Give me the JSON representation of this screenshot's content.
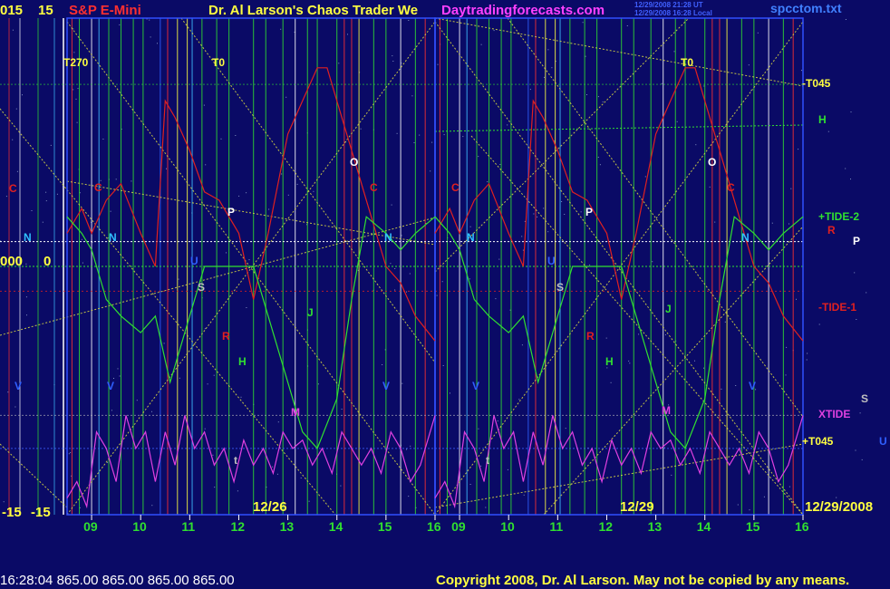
{
  "header": {
    "left_values": [
      "015",
      "15"
    ],
    "instrument": "S&P E-Mini",
    "title": "Dr. Al Larson's Chaos Trader We",
    "site": "Daytradingforecasts.com",
    "stamp_line1": "12/29/2008 21:28 UT",
    "stamp_line2": "12/29/2008 16:28 Local",
    "file": "spcctom.txt"
  },
  "left_axis": {
    "mid_values": [
      "000",
      "0"
    ],
    "low_values": [
      "-15",
      "-15"
    ]
  },
  "status_bar": {
    "time": "16:28:04",
    "quotes": [
      "865.00",
      "865.00",
      "865.00",
      "865.00"
    ],
    "copyright": "Copyright 2008, Dr. Al Larson. May not be copied by any means."
  },
  "colors": {
    "background": "#0a0a66",
    "price": "#e02020",
    "tide": "#30e030",
    "xtide": "#e040e0",
    "guides": "#e0e040"
  },
  "chart_data": {
    "type": "line",
    "title": "S&P E-Mini",
    "sessions": [
      {
        "date_label": "12/26",
        "hours": [
          "09",
          "10",
          "11",
          "12",
          "13",
          "14",
          "15",
          "16"
        ]
      },
      {
        "date_label": "12/29",
        "hours": [
          "09",
          "10",
          "11",
          "12",
          "13",
          "14",
          "15",
          "16"
        ]
      }
    ],
    "end_date_label": "12/29/2008",
    "x_range": [
      8.5,
      16.0
    ],
    "y_range": [
      -15,
      15
    ],
    "right_labels": [
      {
        "text": "-T045",
        "color": "#ffff40"
      },
      {
        "text": "H",
        "color": "#30e030"
      },
      {
        "text": "+TIDE-2",
        "color": "#30e030"
      },
      {
        "text": "R",
        "color": "#e02020"
      },
      {
        "text": "P",
        "color": "#ffffff"
      },
      {
        "text": "-TIDE-1",
        "color": "#e02020"
      },
      {
        "text": "S",
        "color": "#c0c0c0"
      },
      {
        "text": "XTIDE",
        "color": "#e040e0"
      },
      {
        "text": "+T045",
        "color": "#ffff40"
      },
      {
        "text": "U",
        "color": "#3060ff"
      }
    ],
    "markers": [
      {
        "text": "T270",
        "color": "#ffff40"
      },
      {
        "text": "T0",
        "color": "#ffff40"
      },
      {
        "text": "T0",
        "color": "#ffff40"
      },
      {
        "text": "C",
        "color": "#e02020"
      },
      {
        "text": "C",
        "color": "#e02020"
      },
      {
        "text": "C",
        "color": "#e02020"
      },
      {
        "text": "C",
        "color": "#e02020"
      },
      {
        "text": "C",
        "color": "#e02020"
      },
      {
        "text": "N",
        "color": "#30c0ff"
      },
      {
        "text": "N",
        "color": "#30c0ff"
      },
      {
        "text": "N",
        "color": "#30c0ff"
      },
      {
        "text": "N",
        "color": "#30c0ff"
      },
      {
        "text": "N",
        "color": "#30c0ff"
      },
      {
        "text": "U",
        "color": "#3060ff"
      },
      {
        "text": "U",
        "color": "#3060ff"
      },
      {
        "text": "S",
        "color": "#c0c0c0"
      },
      {
        "text": "S",
        "color": "#c0c0c0"
      },
      {
        "text": "P",
        "color": "#ffffff"
      },
      {
        "text": "P",
        "color": "#ffffff"
      },
      {
        "text": "O",
        "color": "#ffffff"
      },
      {
        "text": "O",
        "color": "#ffffff"
      },
      {
        "text": "R",
        "color": "#e02020"
      },
      {
        "text": "R",
        "color": "#e02020"
      },
      {
        "text": "H",
        "color": "#30e030"
      },
      {
        "text": "H",
        "color": "#30e030"
      },
      {
        "text": "J",
        "color": "#30e030"
      },
      {
        "text": "J",
        "color": "#30e030"
      },
      {
        "text": "M",
        "color": "#e040e0"
      },
      {
        "text": "M",
        "color": "#e040e0"
      },
      {
        "text": "V",
        "color": "#3060ff"
      },
      {
        "text": "V",
        "color": "#3060ff"
      },
      {
        "text": "V",
        "color": "#3060ff"
      },
      {
        "text": "V",
        "color": "#3060ff"
      },
      {
        "text": "V",
        "color": "#3060ff"
      },
      {
        "text": "t",
        "color": "#c0c0c0"
      },
      {
        "text": "t",
        "color": "#c0c0c0"
      }
    ],
    "series": [
      {
        "name": "",
        "color": "#e02020",
        "x": [
          8.5,
          8.8,
          9.0,
          9.3,
          9.6,
          10.0,
          10.3,
          10.5,
          10.7,
          11.0,
          11.3,
          11.6,
          12.0,
          12.3,
          12.6,
          13.0,
          13.3,
          13.6,
          13.8,
          14.0,
          14.3,
          14.6,
          15.0,
          15.3,
          15.6,
          16.0
        ],
        "y": [
          2,
          3.5,
          2,
          4,
          5,
          2,
          0,
          10,
          9,
          7,
          4.5,
          4,
          2,
          -2,
          2,
          8,
          10,
          12,
          12,
          10,
          7,
          4,
          0,
          -1,
          -3,
          -4.5
        ]
      },
      {
        "name": "",
        "color": "#30e030",
        "x": [
          8.5,
          8.8,
          9.0,
          9.3,
          9.6,
          10.0,
          10.3,
          10.6,
          11.0,
          11.3,
          11.6,
          12.0,
          12.3,
          12.6,
          13.0,
          13.3,
          13.6,
          14.0,
          14.3,
          14.6,
          15.0,
          15.3,
          15.6,
          16.0
        ],
        "y": [
          3,
          2,
          1,
          -2,
          -3,
          -4,
          -3,
          -7,
          -3,
          0,
          0,
          0,
          0,
          -3,
          -7,
          -10,
          -11,
          -8,
          -2,
          3,
          2,
          1,
          2,
          3
        ]
      },
      {
        "name": "",
        "color": "#e040e0",
        "x": [
          8.5,
          8.7,
          8.9,
          9.1,
          9.3,
          9.5,
          9.7,
          9.9,
          10.1,
          10.3,
          10.5,
          10.7,
          10.9,
          11.1,
          11.3,
          11.5,
          11.7,
          11.9,
          12.1,
          12.3,
          12.5,
          12.7,
          12.9,
          13.1,
          13.3,
          13.5,
          13.7,
          13.9,
          14.1,
          14.3,
          14.5,
          14.7,
          14.9,
          15.1,
          15.3,
          15.5,
          15.7,
          16.0
        ],
        "y": [
          -14,
          -13,
          -14.5,
          -10,
          -11,
          -13,
          -9,
          -11,
          -10,
          -13,
          -10,
          -12,
          -9,
          -11,
          -10,
          -12,
          -11,
          -13,
          -10.5,
          -12,
          -11,
          -12.5,
          -10,
          -11,
          -10.5,
          -12,
          -11,
          -12.5,
          -10,
          -11,
          -12,
          -11,
          -12.5,
          -10,
          -11,
          -13,
          -12,
          -9
        ]
      }
    ]
  }
}
